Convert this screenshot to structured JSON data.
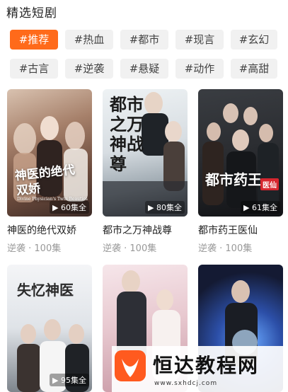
{
  "section": {
    "title": "精选短剧"
  },
  "tags": [
    "#推荐",
    "#热血",
    "#都市",
    "#现言",
    "#玄幻",
    "#古言",
    "#逆袭",
    "#悬疑",
    "#动作",
    "#高甜"
  ],
  "cards": [
    {
      "title": "神医的绝代双娇",
      "meta": "逆袭 · 100集",
      "badge": "60集全",
      "poster_text": "神医的绝代双娇",
      "poster_small": "Divine Physician's Twin Beauties"
    },
    {
      "title": "都市之万神战尊",
      "meta": "逆袭 · 100集",
      "badge": "80集全",
      "poster_text": "都市之万神战尊",
      "poster_small": ""
    },
    {
      "title": "都市药王医仙",
      "meta": "逆袭 · 100集",
      "badge": "61集全",
      "poster_text": "都市药王",
      "poster_small": "医仙"
    },
    {
      "title": "",
      "meta": "",
      "badge": "95集全",
      "poster_text": "失忆神医",
      "poster_small": ""
    },
    {
      "title": "",
      "meta": "",
      "badge": "",
      "poster_text": "",
      "poster_small": ""
    },
    {
      "title": "",
      "meta": "",
      "badge": "",
      "poster_text": "",
      "poster_small": ""
    }
  ],
  "watermark": {
    "text": "恒达教程网",
    "url": "www.sxhdcj.com"
  },
  "colors": {
    "accent": "#ff6a1a",
    "tag_bg": "#f1f1f1"
  }
}
